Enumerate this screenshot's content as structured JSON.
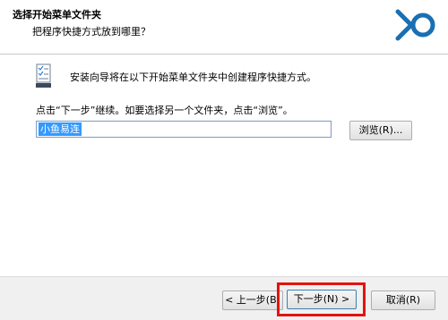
{
  "header": {
    "title": "选择开始菜单文件夹",
    "subtitle": "把程序快捷方式放到哪里？"
  },
  "content": {
    "instruction": "安装向导将在以下开始菜单文件夹中创建程序快捷方式。",
    "hint": "点击“下一步”继续。如要选择另一个文件夹，点击“浏览”。",
    "folder_value": "小鱼易连",
    "browse_label": "浏览(R)..."
  },
  "footer": {
    "back_label": "< 上一步(B)",
    "next_label": "下一步(N) >",
    "cancel_label": "取消(R)"
  },
  "colors": {
    "accent": "#1a6fb3",
    "highlight": "#e2130f",
    "selection": "#3399ff"
  },
  "icons": [
    "brand-logo",
    "wizard-checklist-icon"
  ]
}
